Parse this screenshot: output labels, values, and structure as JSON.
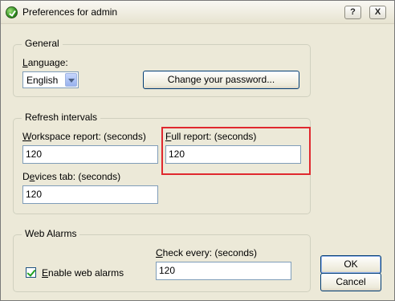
{
  "window": {
    "title": "Preferences for admin",
    "help_label": "?",
    "close_label": "X"
  },
  "general": {
    "legend": "General",
    "language_label": "Language:",
    "language_value": "English",
    "change_password_label": "Change your password..."
  },
  "refresh": {
    "legend": "Refresh intervals",
    "workspace_label": "Workspace report: (seconds)",
    "workspace_value": "120",
    "full_label": "Full report: (seconds)",
    "full_value": "120",
    "devices_label": "Devices tab: (seconds)",
    "devices_value": "120"
  },
  "web_alarms": {
    "legend": "Web Alarms",
    "check_every_label": "Check every: (seconds)",
    "check_every_value": "120",
    "enable_label": "Enable web alarms",
    "enable_checked": true
  },
  "actions": {
    "ok_label": "OK",
    "cancel_label": "Cancel"
  }
}
